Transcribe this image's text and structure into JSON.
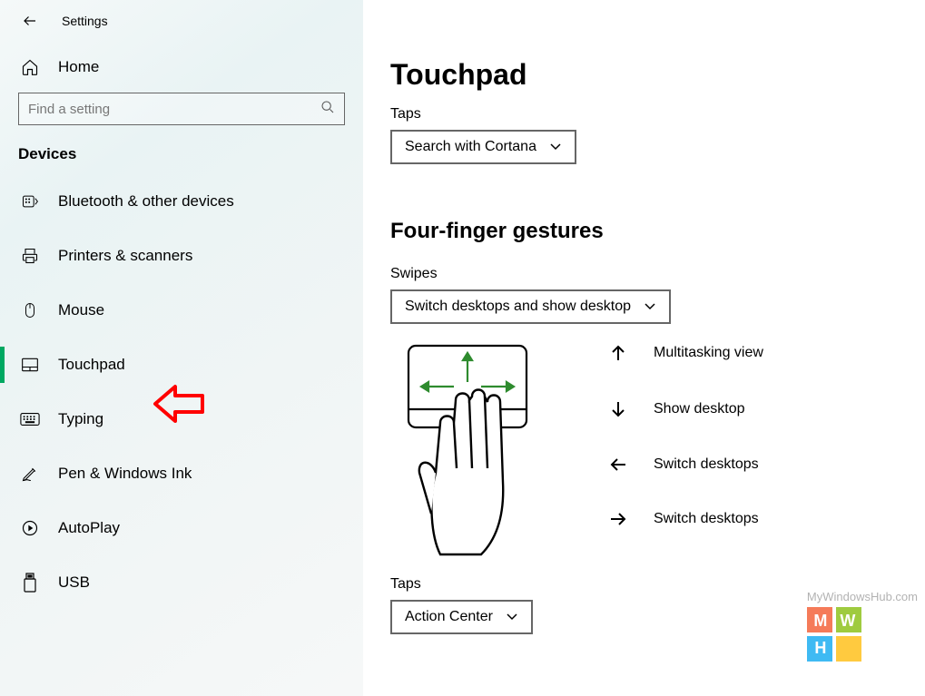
{
  "app_title": "Settings",
  "home_label": "Home",
  "search_placeholder": "Find a setting",
  "section_header": "Devices",
  "nav": [
    {
      "id": "bluetooth",
      "label": "Bluetooth & other devices"
    },
    {
      "id": "printers",
      "label": "Printers & scanners"
    },
    {
      "id": "mouse",
      "label": "Mouse"
    },
    {
      "id": "touchpad",
      "label": "Touchpad",
      "active": true
    },
    {
      "id": "typing",
      "label": "Typing"
    },
    {
      "id": "pen",
      "label": "Pen & Windows Ink"
    },
    {
      "id": "autoplay",
      "label": "AutoPlay"
    },
    {
      "id": "usb",
      "label": "USB"
    }
  ],
  "page": {
    "title": "Touchpad",
    "taps_label": "Taps",
    "taps_value": "Search with Cortana",
    "four_finger_title": "Four-finger gestures",
    "swipes_label": "Swipes",
    "swipes_value": "Switch desktops and show desktop",
    "gesture_map": {
      "up": "Multitasking view",
      "down": "Show desktop",
      "left": "Switch desktops",
      "right": "Switch desktops"
    },
    "taps2_label": "Taps",
    "taps2_value": "Action Center"
  },
  "watermark_text": "MyWindowsHub.com"
}
